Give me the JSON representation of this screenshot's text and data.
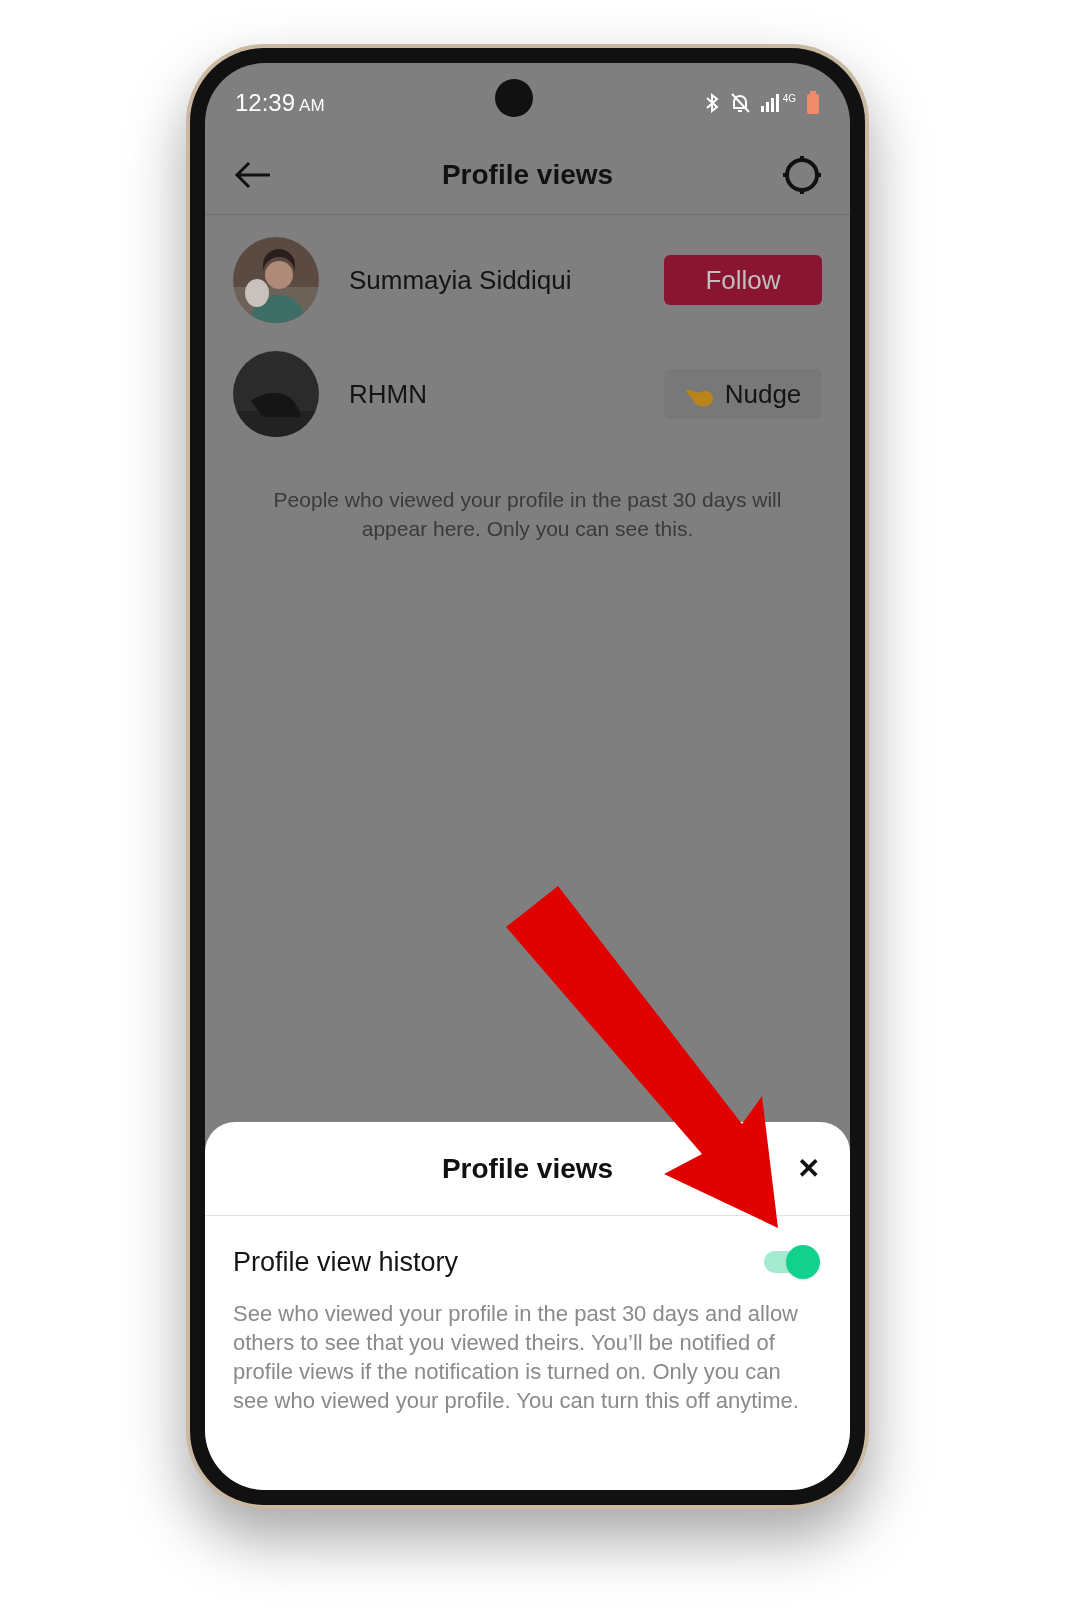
{
  "status_bar": {
    "time": "12:39",
    "meridiem": "AM",
    "network": "4G"
  },
  "header": {
    "title": "Profile views"
  },
  "viewers": [
    {
      "name": "Summayia Siddiqui",
      "action": {
        "kind": "follow",
        "label": "Follow"
      }
    },
    {
      "name": "RHMN",
      "action": {
        "kind": "nudge",
        "label": "Nudge"
      }
    }
  ],
  "caption": "People who viewed your profile in the past 30 days will appear here. Only you can see this.",
  "sheet": {
    "title": "Profile views",
    "close": "✕",
    "setting": {
      "label": "Profile view history",
      "on": true,
      "description": "See who viewed your profile in the past 30 days and allow others to see that you viewed theirs. You’ll be notified of profile views if the notification is turned on. Only you can see who viewed your profile. You can turn this off anytime."
    }
  }
}
